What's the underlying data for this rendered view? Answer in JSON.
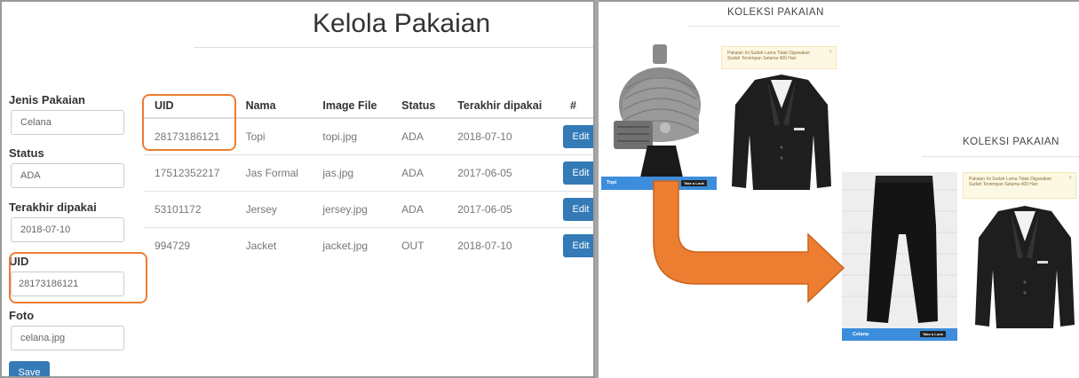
{
  "left": {
    "title": "Kelola Pakaian",
    "form": {
      "jenis_label": "Jenis Pakaian",
      "jenis_value": "Celana",
      "status_label": "Status",
      "status_value": "ADA",
      "terakhir_label": "Terakhir dipakai",
      "terakhir_value": "2018-07-10",
      "uid_label": "UID",
      "uid_value": "28173186121",
      "foto_label": "Foto",
      "foto_value": "celana.jpg",
      "save_label": "Save"
    },
    "table": {
      "headers": [
        "UID",
        "Nama",
        "Image File",
        "Status",
        "Terakhir dipakai",
        "#"
      ],
      "rows": [
        {
          "uid": "28173186121",
          "nama": "Topi",
          "image": "topi.jpg",
          "status": "ADA",
          "tanggal": "2018-07-10",
          "action": "Edit"
        },
        {
          "uid": "17512352217",
          "nama": "Jas Formal",
          "image": "jas.jpg",
          "status": "ADA",
          "tanggal": "2017-06-05",
          "action": "Edit"
        },
        {
          "uid": "53101172",
          "nama": "Jersey",
          "image": "jersey.jpg",
          "status": "ADA",
          "tanggal": "2017-06-05",
          "action": "Edit"
        },
        {
          "uid": "994729",
          "nama": "Jacket",
          "image": "jacket.jpg",
          "status": "OUT",
          "tanggal": "2018-07-10",
          "action": "Edit"
        }
      ]
    }
  },
  "right": {
    "top": {
      "title": "KOLEKSI PAKAIAN",
      "item_name": "Topi",
      "button": "Take a Look",
      "note_line1": "Pakaian Ini Sudah Lama Tidak Digunakan",
      "note_line2": "Sudah Tersimpan Selama 400 Hari",
      "close": "×"
    },
    "bottom": {
      "title": "KOLEKSI PAKAIAN",
      "item_name": "Celana",
      "button": "Take a Look",
      "note_line1": "Pakaian Ini Sudah Lama Tidak Digunakan",
      "note_line2": "Sudah Tersimpan Selama 400 Hari",
      "close": "×"
    }
  },
  "colors": {
    "primary": "#337ab7",
    "highlight": "#ed7d31",
    "card_bar": "#3c8ddc"
  },
  "icons": [
    "flow-arrow-icon",
    "close-icon"
  ]
}
